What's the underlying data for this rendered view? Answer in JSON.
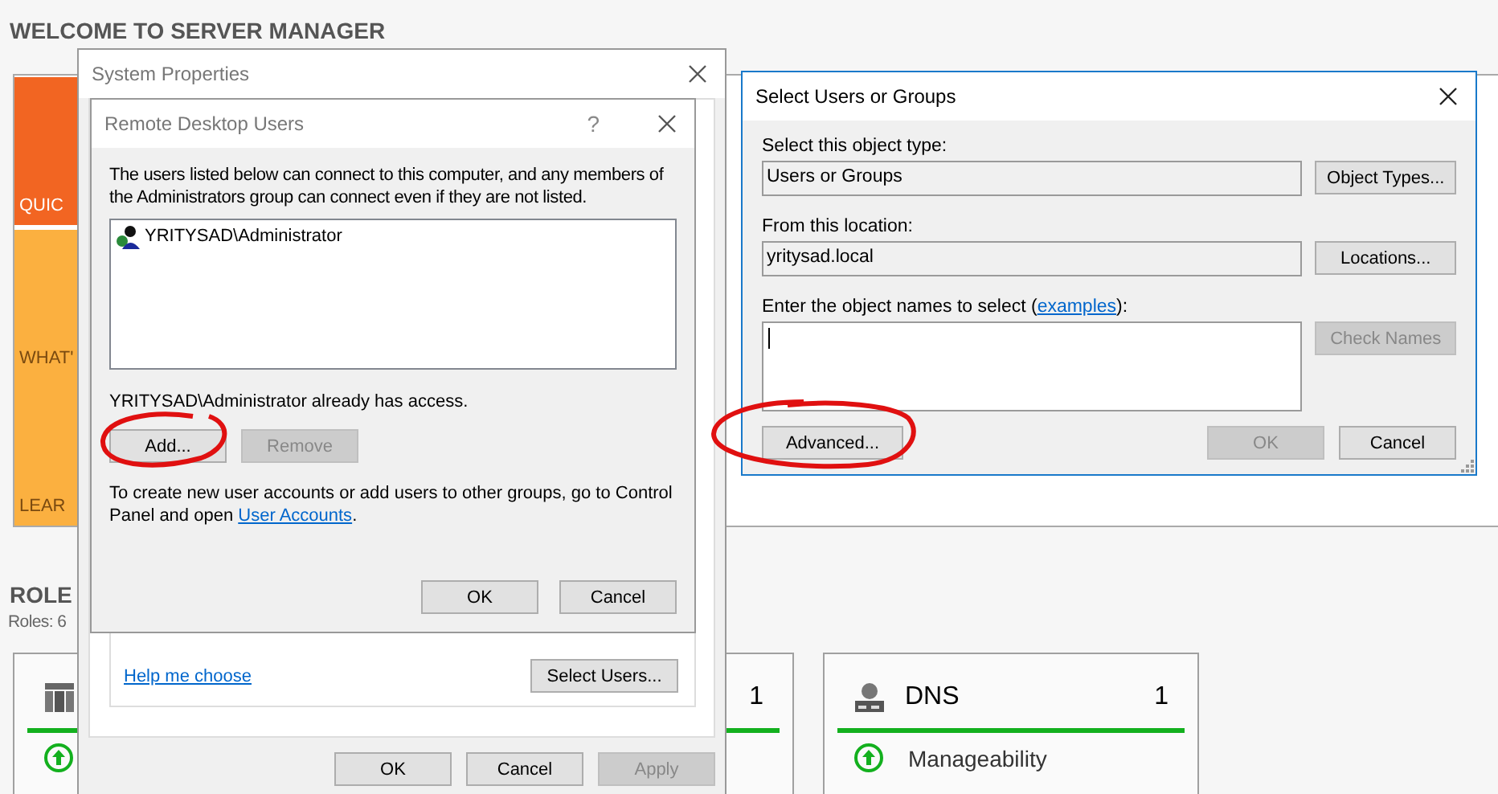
{
  "server_manager": {
    "title": "WELCOME TO SERVER MANAGER",
    "tiles": [
      {
        "label": "QUIC",
        "color": "#f26522"
      },
      {
        "label": "WHAT'",
        "color": "#fbb040"
      },
      {
        "label": "LEAR",
        "color": "#fbb040"
      }
    ],
    "roles_heading": "ROLE",
    "roles_count": "Roles: 6",
    "role_tiles": [
      {
        "count": "1"
      },
      {
        "name": "DNS",
        "count": "1",
        "status": "Manageability"
      }
    ]
  },
  "system_properties": {
    "title": "System Properties",
    "help_link": "Help me choose",
    "select_button": "Select Users...",
    "buttons": [
      {
        "label": "OK",
        "disabled": false
      },
      {
        "label": "Cancel",
        "disabled": false
      },
      {
        "label": "Apply",
        "disabled": true
      }
    ]
  },
  "remote_desktop_users": {
    "title": "Remote Desktop Users",
    "help_glyph": "?",
    "description": "The users listed below can connect to this computer, and any members of the Administrators group can connect even if they are not listed.",
    "users": [
      {
        "name": "YRITYSAD\\Administrator"
      }
    ],
    "status": "YRITYSAD\\Administrator already has access.",
    "list_buttons": [
      {
        "label": "Add...",
        "disabled": false
      },
      {
        "label": "Remove",
        "disabled": true
      }
    ],
    "note": "To create new user accounts or add users to other groups, go to Control Panel and open ",
    "note_link": "User Accounts",
    "note_end": ".",
    "buttons": [
      {
        "label": "OK",
        "disabled": false
      },
      {
        "label": "Cancel",
        "disabled": false
      }
    ]
  },
  "select_users": {
    "title": "Select Users or Groups",
    "fields": [
      {
        "label": "Select this object type:",
        "value": "Users or Groups",
        "button": {
          "label": "Object Types...",
          "disabled": false
        }
      },
      {
        "label": "From this location:",
        "value": "yritysad.local",
        "button": {
          "label": "Locations...",
          "disabled": false
        }
      }
    ],
    "names_label": "Enter the object names to select (",
    "names_link": "examples",
    "names_end": "):",
    "names_focused": true,
    "check_button": {
      "label": "Check Names",
      "disabled": true
    },
    "advanced_button": "Advanced...",
    "buttons": [
      {
        "label": "OK",
        "disabled": true
      },
      {
        "label": "Cancel",
        "disabled": false
      }
    ]
  }
}
